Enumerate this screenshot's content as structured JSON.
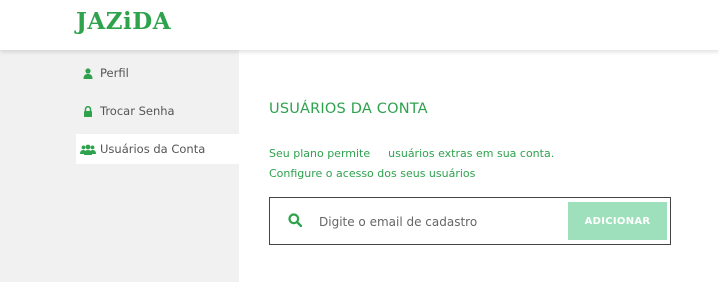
{
  "brand": {
    "logo_text": "JAZiDA",
    "accent_color": "#2fa24e"
  },
  "sidebar": {
    "items": [
      {
        "label": "Perfil",
        "icon": "user-icon",
        "active": false
      },
      {
        "label": "Trocar Senha",
        "icon": "lock-icon",
        "active": false
      },
      {
        "label": "Usuários da Conta",
        "icon": "users-icon",
        "active": true
      }
    ]
  },
  "main": {
    "title": "USUÁRIOS DA CONTA",
    "plan_text_prefix": "Seu plano permite",
    "plan_text_suffix": "usuários extras em sua conta.",
    "config_text": "Configure o acesso dos seus usuários",
    "search": {
      "icon": "search-icon",
      "placeholder": "Digite o email de cadastro",
      "value": ""
    },
    "add_button_label": "ADICIONAR"
  }
}
